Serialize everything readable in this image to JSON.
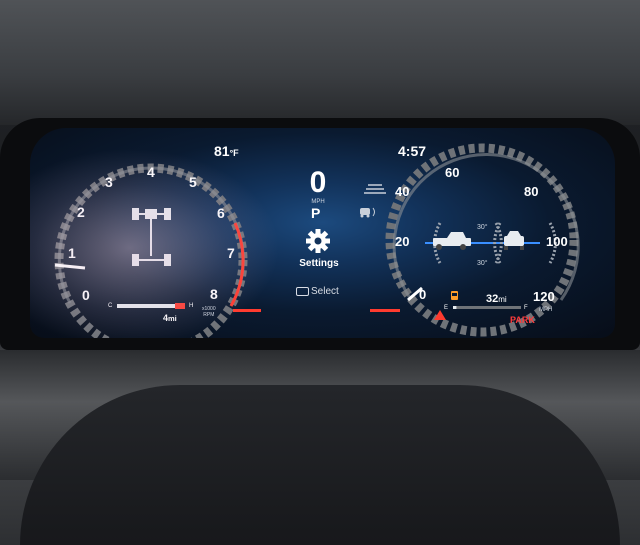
{
  "status": {
    "outside_temp_value": "81",
    "outside_temp_unit": "°F",
    "clock": "4:57"
  },
  "tachometer": {
    "ticks": [
      "0",
      "1",
      "2",
      "3",
      "4",
      "5",
      "6",
      "7",
      "8"
    ],
    "unit": "x1000\nRPM",
    "redline_color": "#ff3b2f",
    "coolant_low": "C",
    "coolant_high": "H",
    "trip_value": "4",
    "trip_unit": "mi"
  },
  "center": {
    "speed": "0",
    "speed_unit": "MPH",
    "gear": "P",
    "menu_item": "Settings",
    "select_hint": "Select",
    "icon_settings": "gear-icon",
    "icon_lane": "lane-assist-icon",
    "icon_traction": "traction-control-icon"
  },
  "speedometer": {
    "ticks": [
      "0",
      "20",
      "40",
      "60",
      "80",
      "100",
      "120"
    ],
    "unit": "MPH",
    "pitch_top": "30°",
    "pitch_bottom": "30°",
    "fuel_empty": "E",
    "fuel_full": "F",
    "fuel_range_value": "32",
    "fuel_range_unit": "mi",
    "fuel_level_fraction": 0.05,
    "park_label": "PARK",
    "warning_color": "#ff3b3b"
  }
}
